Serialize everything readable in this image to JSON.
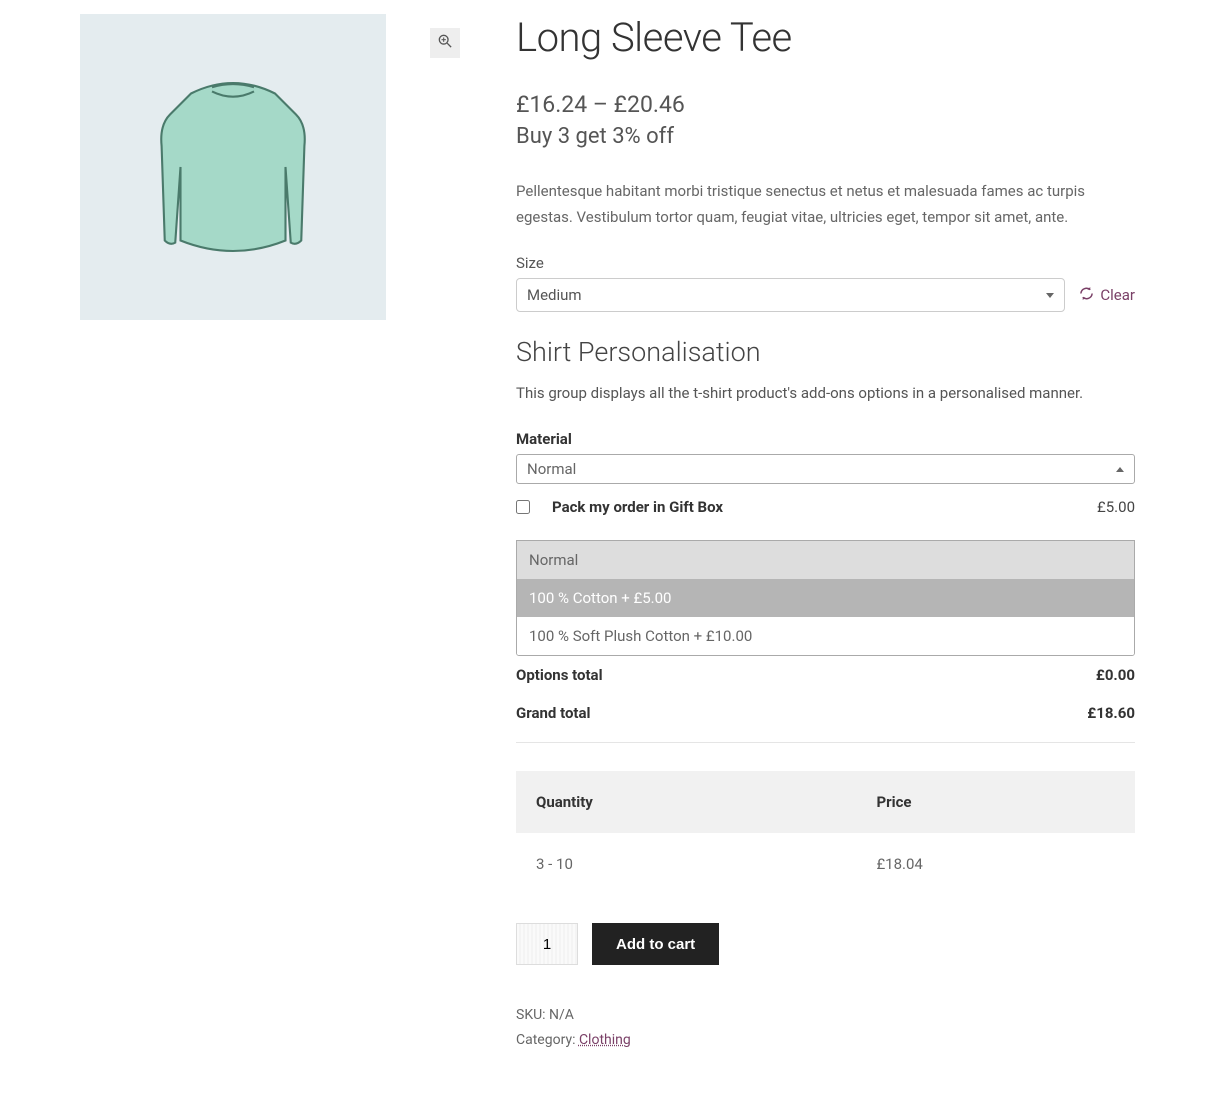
{
  "product": {
    "title": "Long Sleeve Tee",
    "price_range": "£16.24 – £20.46",
    "promo": "Buy 3 get 3% off",
    "description": "Pellentesque habitant morbi tristique senectus et netus et malesuada fames ac turpis egestas. Vestibulum tortor quam, feugiat vitae, ultricies eget, tempor sit amet, ante."
  },
  "size": {
    "label": "Size",
    "selected": "Medium",
    "clear": "Clear"
  },
  "personalisation": {
    "heading": "Shirt Personalisation",
    "desc": "This group displays all the t-shirt product's add-ons options in a personalised manner."
  },
  "material": {
    "label": "Material",
    "selected": "Normal",
    "options": [
      "Normal",
      "100 % Cotton + £5.00",
      "100 % Soft Plush Cotton + £10.00"
    ]
  },
  "giftbox": {
    "label": "Pack my order in Gift Box",
    "price": "£5.00",
    "checked": false
  },
  "totals": {
    "options_label": "Options total",
    "options_value": "£0.00",
    "grand_label": "Grand total",
    "grand_value": "£18.60"
  },
  "tier": {
    "qty_header": "Quantity",
    "price_header": "Price",
    "qty": "3 - 10",
    "price": "£18.04"
  },
  "cart": {
    "qty": "1",
    "add": "Add to cart"
  },
  "meta": {
    "sku_label": "SKU: ",
    "sku_value": "N/A",
    "cat_label": "Category: ",
    "cat_value": "Clothing"
  }
}
